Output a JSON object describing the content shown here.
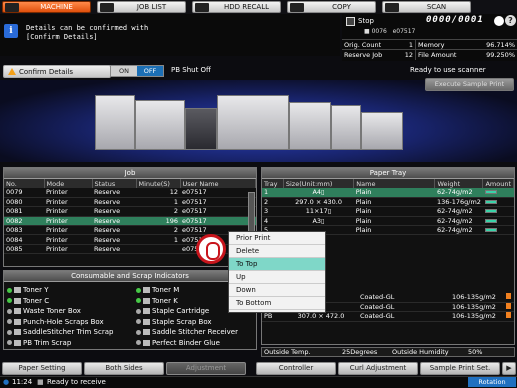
{
  "tabs": [
    {
      "label": "MACHINE",
      "icon": "machine-icon",
      "active": true
    },
    {
      "label": "JOB LIST",
      "icon": "job-list-icon",
      "active": false
    },
    {
      "label": "HDD RECALL",
      "icon": "hdd-icon",
      "active": false
    },
    {
      "label": "COPY",
      "icon": "copy-icon",
      "active": false
    },
    {
      "label": "SCAN",
      "icon": "scan-icon",
      "active": false
    }
  ],
  "info": {
    "line1": "Details can be confirmed with",
    "line2": "[Confirm Details]"
  },
  "status": {
    "stop_label": "Stop",
    "copies": "0000/0001",
    "user_id": "0076",
    "user_name": "e07517",
    "orig_count_label": "Orig. Count",
    "orig_count": "1",
    "memory_label": "Memory",
    "memory": "96.714%",
    "reserve_label": "Reserve Job",
    "reserve": "12",
    "file_label": "File Amount",
    "file": "99.250%"
  },
  "controls": {
    "confirm_label": "Confirm Details",
    "on": "ON",
    "off": "OFF",
    "pb_shut": "PB Shut Off",
    "ready": "Ready to use scanner",
    "sample": "Execute Sample Print"
  },
  "job": {
    "title": "Job",
    "headers": [
      "No.",
      "Mode",
      "Status",
      "Minute(S)",
      "User Name"
    ],
    "rows": [
      [
        "0079",
        "Printer",
        "Reserve",
        "12",
        "e07517"
      ],
      [
        "0080",
        "Printer",
        "Reserve",
        "1",
        "e07517"
      ],
      [
        "0081",
        "Printer",
        "Reserve",
        "2",
        "e07517"
      ],
      [
        "0082",
        "Printer",
        "Reserve",
        "196",
        "e07517"
      ],
      [
        "0083",
        "Printer",
        "Reserve",
        "2",
        "e07517"
      ],
      [
        "0084",
        "Printer",
        "Reserve",
        "1",
        "e07517"
      ],
      [
        "0085",
        "Printer",
        "Reserve",
        "",
        "e07517"
      ]
    ],
    "selected": 3
  },
  "tray": {
    "title": "Paper Tray",
    "headers": [
      "Tray",
      "Size(Unit:mm)",
      "Name",
      "Weight",
      "Amount"
    ],
    "rows": [
      [
        "1",
        "A4▯",
        "Plain",
        "62-74g/m2"
      ],
      [
        "2",
        "297.0 × 430.0",
        "Plain",
        "136-176g/m2"
      ],
      [
        "3",
        "11×17▯",
        "Plain",
        "62-74g/m2"
      ],
      [
        "4",
        "A3▯",
        "Plain",
        "62-74g/m2"
      ],
      [
        "5",
        "",
        "Plain",
        "62-74g/m2"
      ]
    ],
    "lower": [
      [
        "",
        "",
        "Coated-GL",
        "106-135g/m2"
      ],
      [
        "",
        "",
        "Coated-GL",
        "106-135g/m2"
      ],
      [
        "PB",
        "307.0 × 472.0",
        "Coated-GL",
        "106-135g/m2"
      ]
    ]
  },
  "menu": [
    "Prior Print",
    "Delete",
    "To Top",
    "Up",
    "Down",
    "To Bottom"
  ],
  "menu_highlight": 2,
  "consumables": {
    "title": "Consumable and Scrap Indicators",
    "left": [
      "Toner Y",
      "Toner C",
      "Waste Toner Box",
      "Punch-Hole Scraps Box",
      "SaddleStitcher Trim Scrap",
      "PB Trim Scrap"
    ],
    "right": [
      "Toner M",
      "Toner K",
      "Staple Cartridge",
      "Staple Scrap Box",
      "Saddle Stitcher Receiver",
      "Perfect Binder Glue"
    ]
  },
  "env": {
    "temp_label": "Outside Temp.",
    "temp": "25Degrees",
    "hum_label": "Outside Humidity",
    "hum": "50%"
  },
  "footer": [
    "Paper Setting",
    "Both Sides",
    "Adjustment",
    "Controller",
    "Curl Adjustment",
    "Sample Print Set."
  ],
  "statusbar": {
    "time": "11:24",
    "msg": "Ready to receive",
    "rotation": "Rotation"
  },
  "colors": {
    "active_tab": "#e0500c",
    "selection": "#2f7f5c",
    "menu_highlight": "#7fd7c8",
    "accent": "#2070c0"
  }
}
